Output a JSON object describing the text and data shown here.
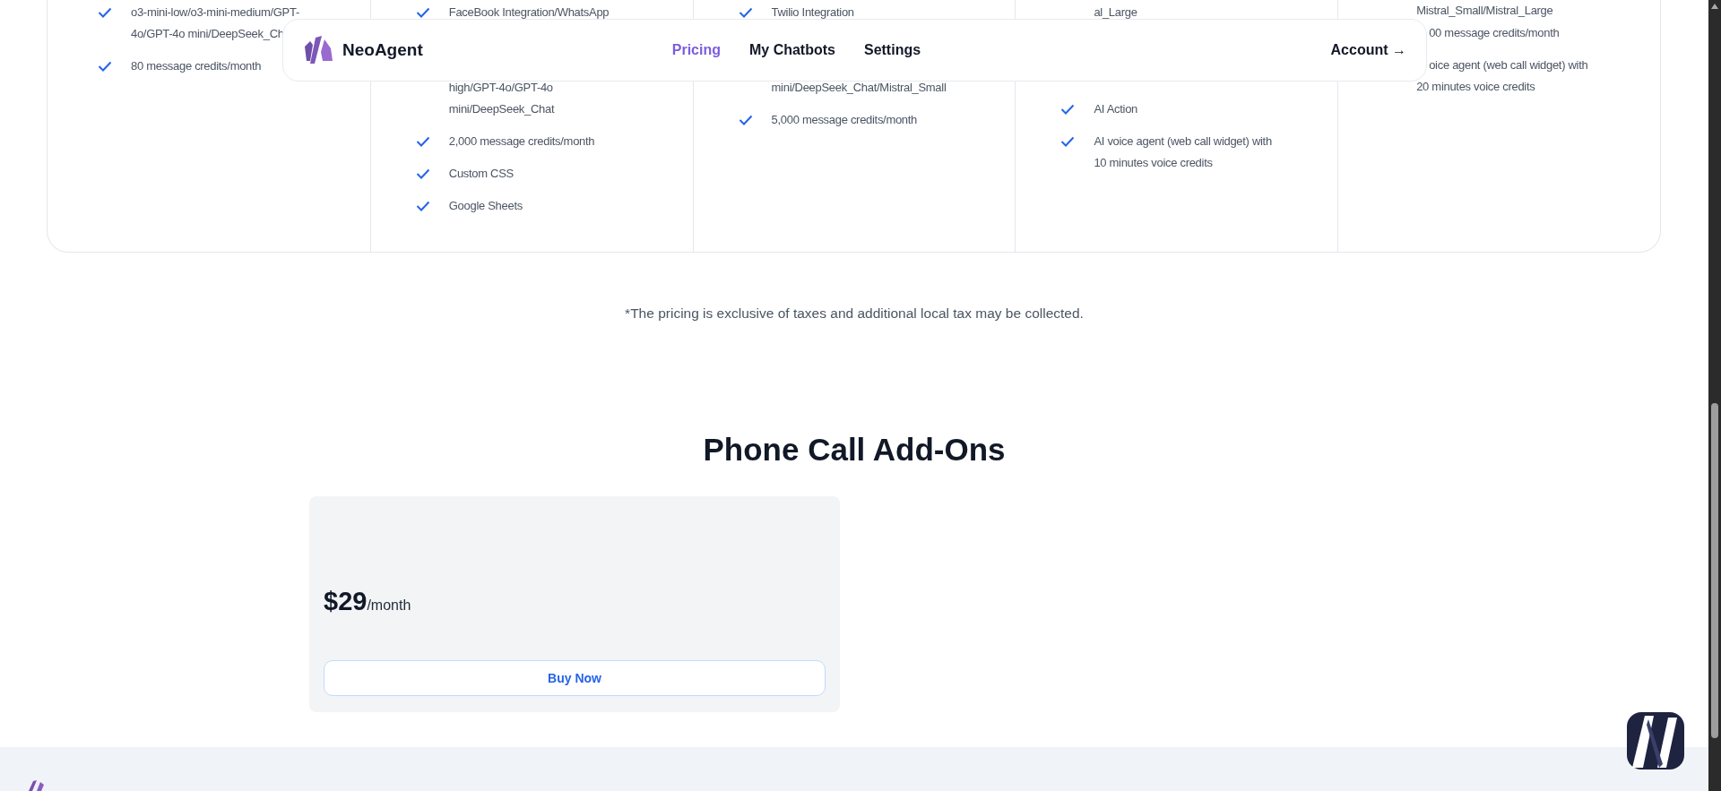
{
  "navbar": {
    "brand": "NeoAgent",
    "links": [
      {
        "label": "Pricing",
        "selected": true
      },
      {
        "label": "My Chatbots",
        "selected": false
      },
      {
        "label": "Settings",
        "selected": false
      }
    ],
    "account": "Account →"
  },
  "plans_table": {
    "columns": [
      {
        "items": [
          {
            "kind": "check",
            "lines": [
              "o3-mini-low/o3-mini-medium/GPT-",
              "4o/GPT-4o mini/DeepSeek_Ch"
            ]
          },
          {
            "kind": "check",
            "lines": [
              "80 message credits/month"
            ]
          }
        ]
      },
      {
        "items": [
          {
            "kind": "check",
            "lines": [
              "FaceBook Integration/WhatsApp"
            ]
          },
          {
            "kind": "continuation",
            "lines": [
              "high/GPT-4o/GPT-4o",
              "mini/DeepSeek_Chat"
            ]
          },
          {
            "kind": "check",
            "lines": [
              "2,000 message credits/month"
            ]
          },
          {
            "kind": "check",
            "lines": [
              "Custom CSS"
            ]
          },
          {
            "kind": "check",
            "lines": [
              "Google Sheets"
            ]
          }
        ]
      },
      {
        "items": [
          {
            "kind": "check",
            "lines": [
              "Twilio Integration"
            ]
          },
          {
            "kind": "continuation",
            "lines": [
              "mini/DeepSeek_Chat/Mistral_Small"
            ]
          },
          {
            "kind": "check",
            "lines": [
              "5,000 message credits/month"
            ]
          }
        ]
      },
      {
        "items": [
          {
            "kind": "continuation",
            "lines": [
              "al_Large"
            ]
          },
          {
            "kind": "check",
            "lines": [
              "AI Action"
            ]
          },
          {
            "kind": "check",
            "lines": [
              "AI voice agent (web call widget) with",
              "10 minutes voice credits"
            ]
          }
        ]
      },
      {
        "items": [
          {
            "kind": "continuation",
            "lines": [
              "Mistral_Small/Mistral_Large"
            ]
          },
          {
            "kind": "partial",
            "lines": [
              "00 message credits/month"
            ]
          },
          {
            "kind": "partial",
            "lines": [
              "oice agent (web call widget) with",
              "20 minutes voice credits"
            ]
          }
        ]
      }
    ]
  },
  "note": "*The pricing is exclusive of taxes and additional local tax may be collected.",
  "addons": {
    "title": "Phone Call Add-Ons",
    "cards": [
      {
        "price": "$29",
        "period": "/month",
        "button": "Buy Now"
      }
    ]
  }
}
